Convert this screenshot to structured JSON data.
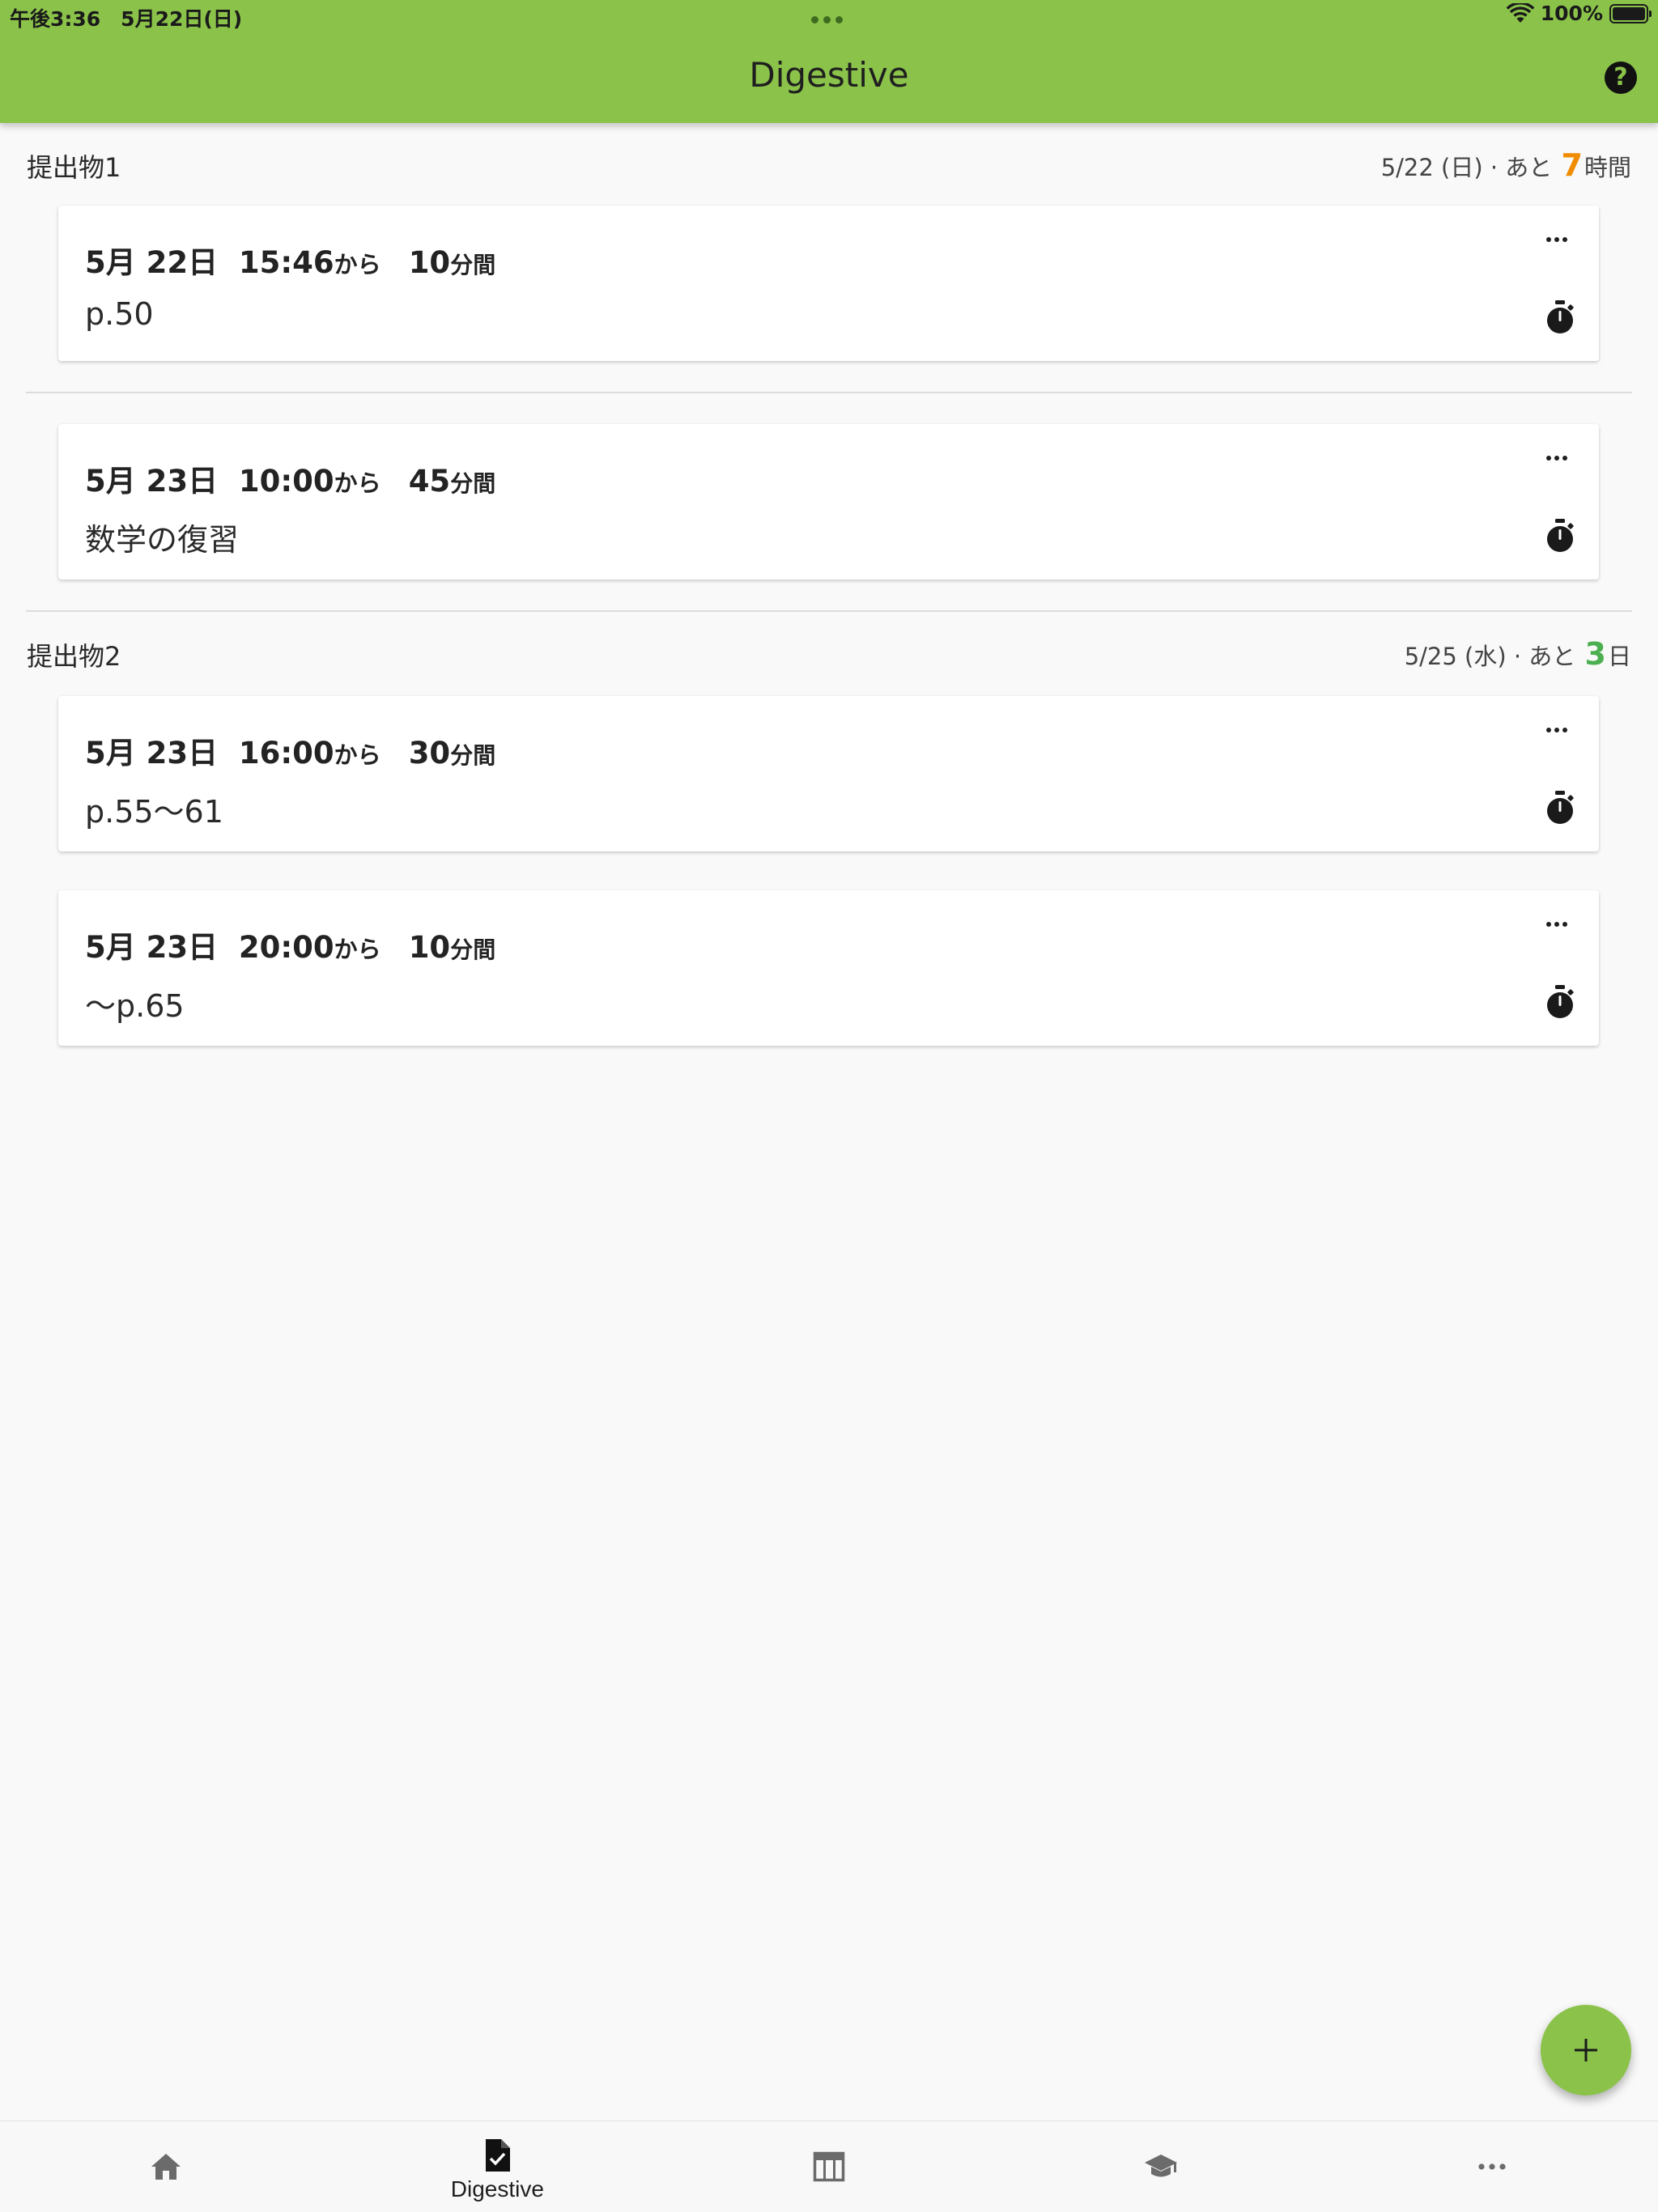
{
  "status_bar": {
    "time_date": "午後3:36　5月22日(日)",
    "battery": "100%"
  },
  "header": {
    "title": "Digestive",
    "accent_color": "#8bc34a"
  },
  "groups": [
    {
      "title": "提出物1",
      "due_prefix": "5/22 (日) · あと ",
      "due_number": "7",
      "due_suffix": "時間",
      "due_color": "#f08c00",
      "tasks": [
        {
          "date": "5月 22日",
          "time": "15:46",
          "kara": "から",
          "duration": "10",
          "unit": "分間",
          "note": "p.50"
        },
        {
          "date": "5月 23日",
          "time": "10:00",
          "kara": "から",
          "duration": "45",
          "unit": "分間",
          "note": "数学の復習"
        }
      ]
    },
    {
      "title": "提出物2",
      "due_prefix": "5/25 (水) · あと ",
      "due_number": "3",
      "due_suffix": "日",
      "due_color": "#4caf50",
      "tasks": [
        {
          "date": "5月 23日",
          "time": "16:00",
          "kara": "から",
          "duration": "30",
          "unit": "分間",
          "note": "p.55〜61"
        },
        {
          "date": "5月 23日",
          "time": "20:00",
          "kara": "から",
          "duration": "10",
          "unit": "分間",
          "note": "〜p.65"
        }
      ]
    }
  ],
  "bottom_nav": {
    "items": [
      {
        "icon": "home-icon",
        "label": ""
      },
      {
        "icon": "assignment-check-icon",
        "label": "Digestive"
      },
      {
        "icon": "timetable-icon",
        "label": ""
      },
      {
        "icon": "school-icon",
        "label": ""
      },
      {
        "icon": "more-horizontal-icon",
        "label": ""
      }
    ],
    "active_index": 1
  }
}
